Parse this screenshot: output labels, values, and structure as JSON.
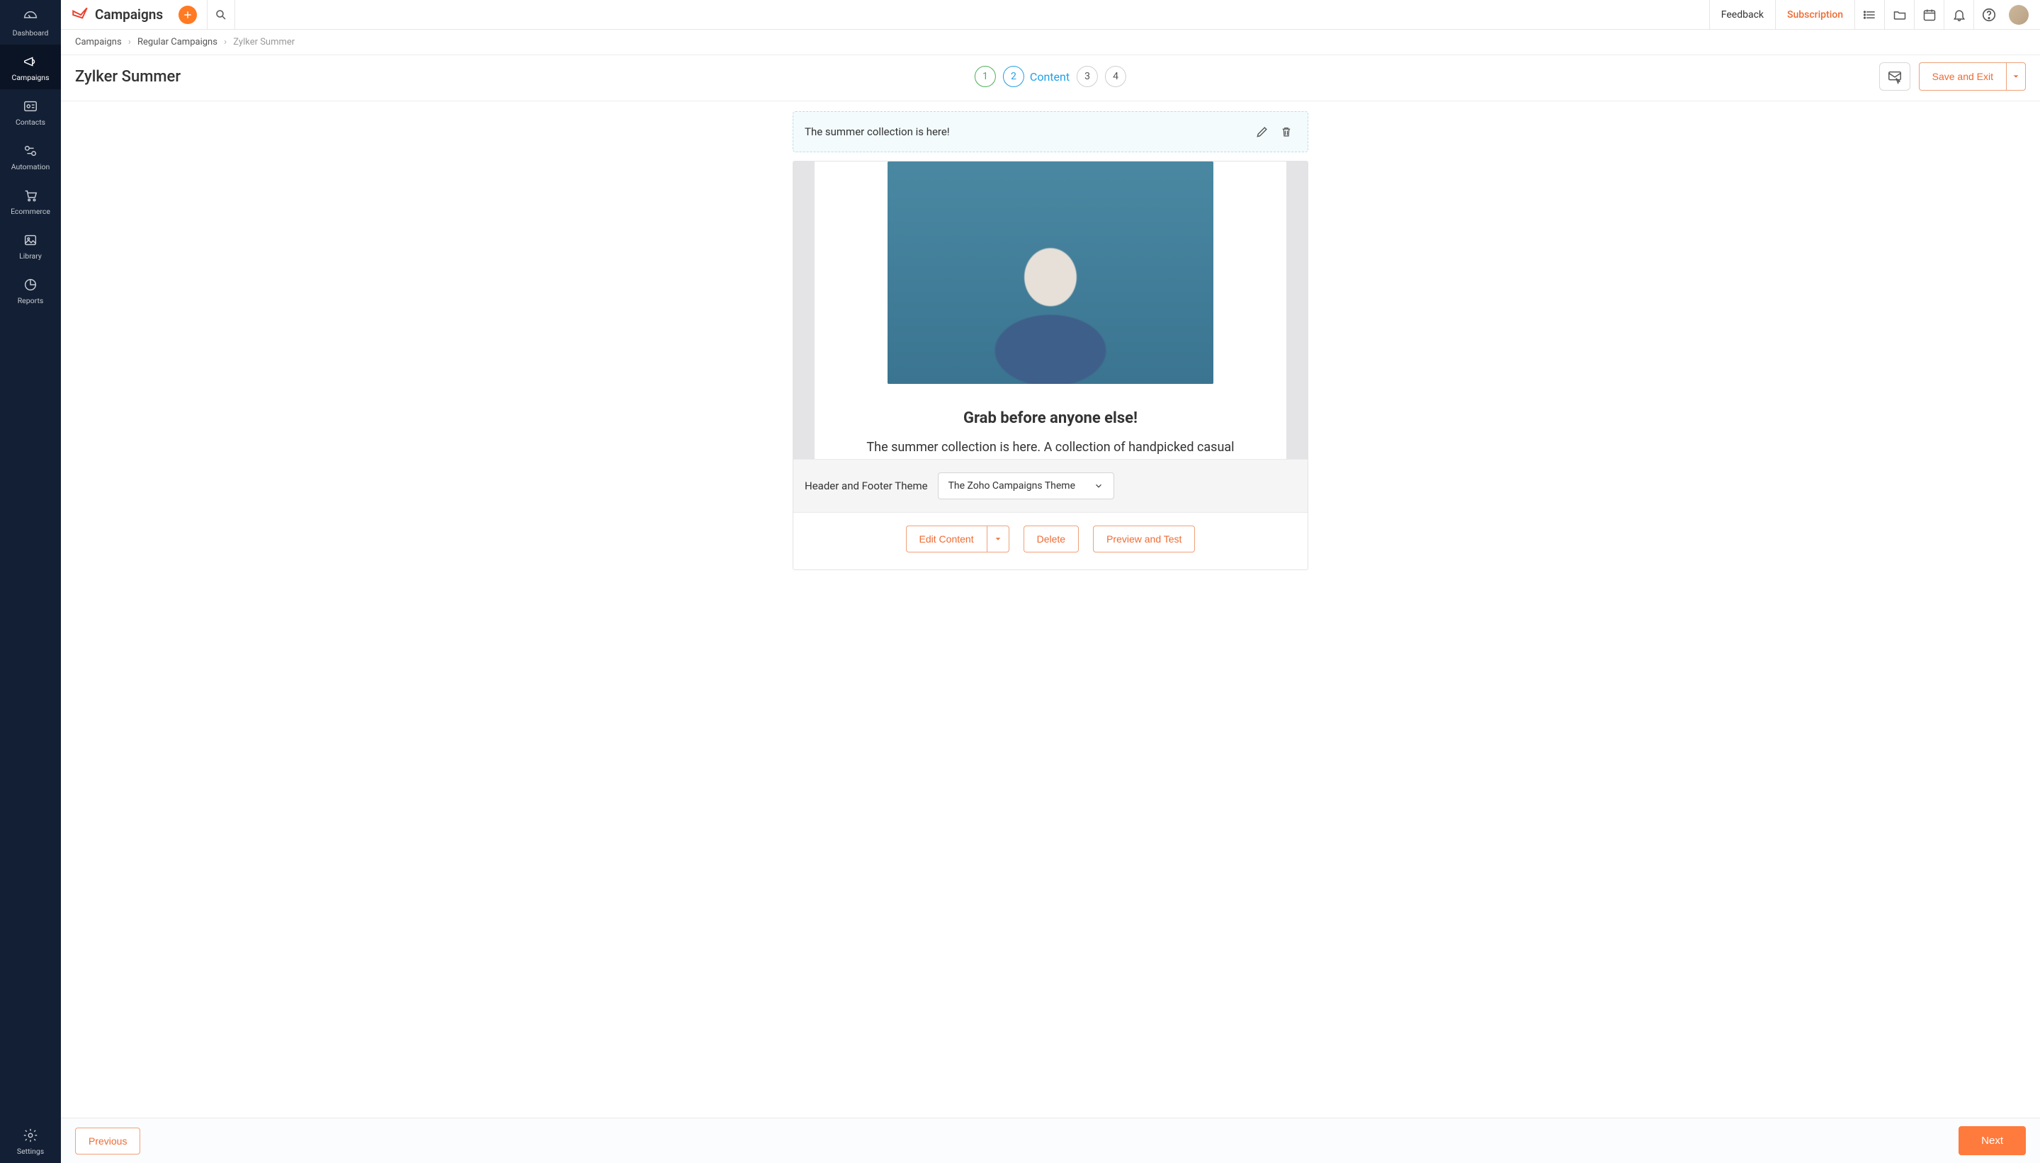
{
  "brand": "Campaigns",
  "header": {
    "feedback": "Feedback",
    "subscription": "Subscription"
  },
  "sidebar": {
    "items": [
      {
        "label": "Dashboard"
      },
      {
        "label": "Campaigns"
      },
      {
        "label": "Contacts"
      },
      {
        "label": "Automation"
      },
      {
        "label": "Ecommerce"
      },
      {
        "label": "Library"
      },
      {
        "label": "Reports"
      }
    ],
    "bottom": {
      "label": "Settings"
    }
  },
  "breadcrumb": {
    "a": "Campaigns",
    "b": "Regular Campaigns",
    "c": "Zylker Summer",
    "sep": "›"
  },
  "page_title": "Zylker Summer",
  "steps": {
    "s1": "1",
    "s2": "2",
    "s2_label": "Content",
    "s3": "3",
    "s4": "4"
  },
  "save_exit_label": "Save and Exit",
  "subject": "The summer collection is here!",
  "preview": {
    "heading": "Grab before anyone else!",
    "body": "The summer collection is here. A collection of handpicked casual"
  },
  "theme": {
    "label": "Header and Footer Theme",
    "value": "The Zoho Campaigns Theme"
  },
  "actions": {
    "edit": "Edit Content",
    "delete": "Delete",
    "preview": "Preview and Test"
  },
  "footer": {
    "previous": "Previous",
    "next": "Next"
  }
}
